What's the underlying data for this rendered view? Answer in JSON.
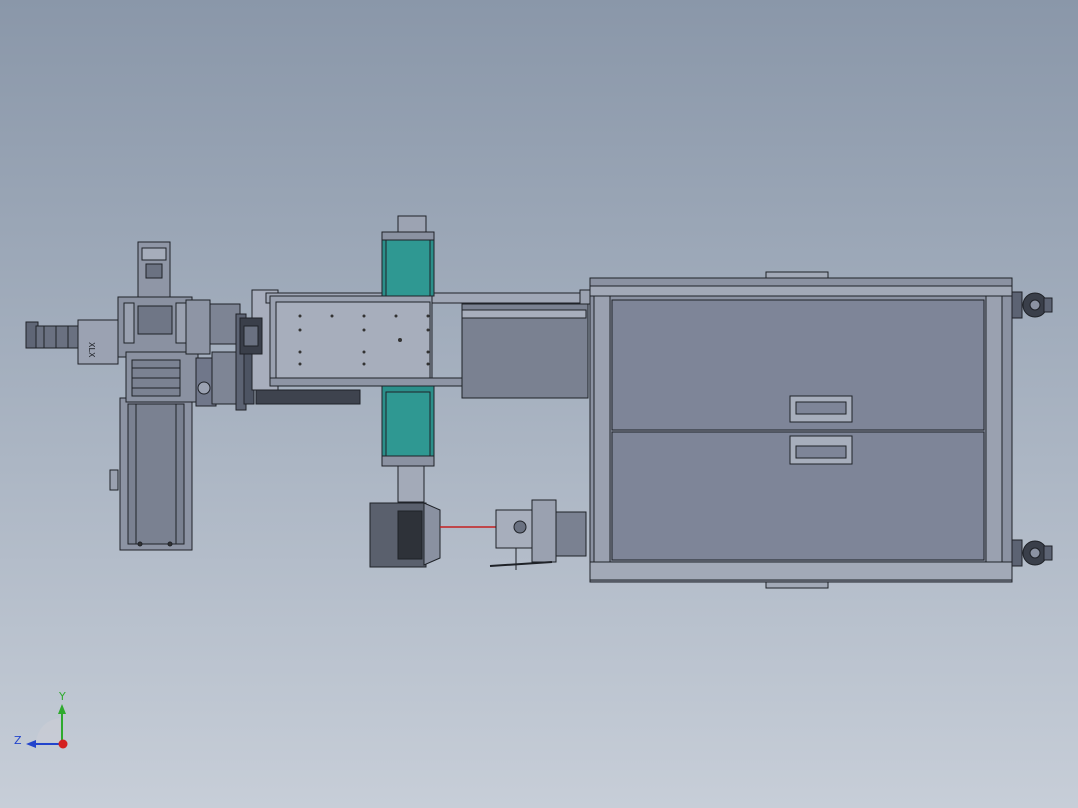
{
  "viewer": {
    "background_top": "#8a97a9",
    "background_bottom": "#c7ced8",
    "model_fill": "#7f8799",
    "model_fill_light": "#9ba2b2",
    "model_edge": "#1f2228",
    "accent_teal": "#2b8f8a",
    "laser_red": "#c42020"
  },
  "triad": {
    "y_label": "Y",
    "z_label": "Z",
    "y_color": "#2eaa2e",
    "z_color": "#2244cc",
    "x_color": "#d42020"
  },
  "part_label": "XLX"
}
